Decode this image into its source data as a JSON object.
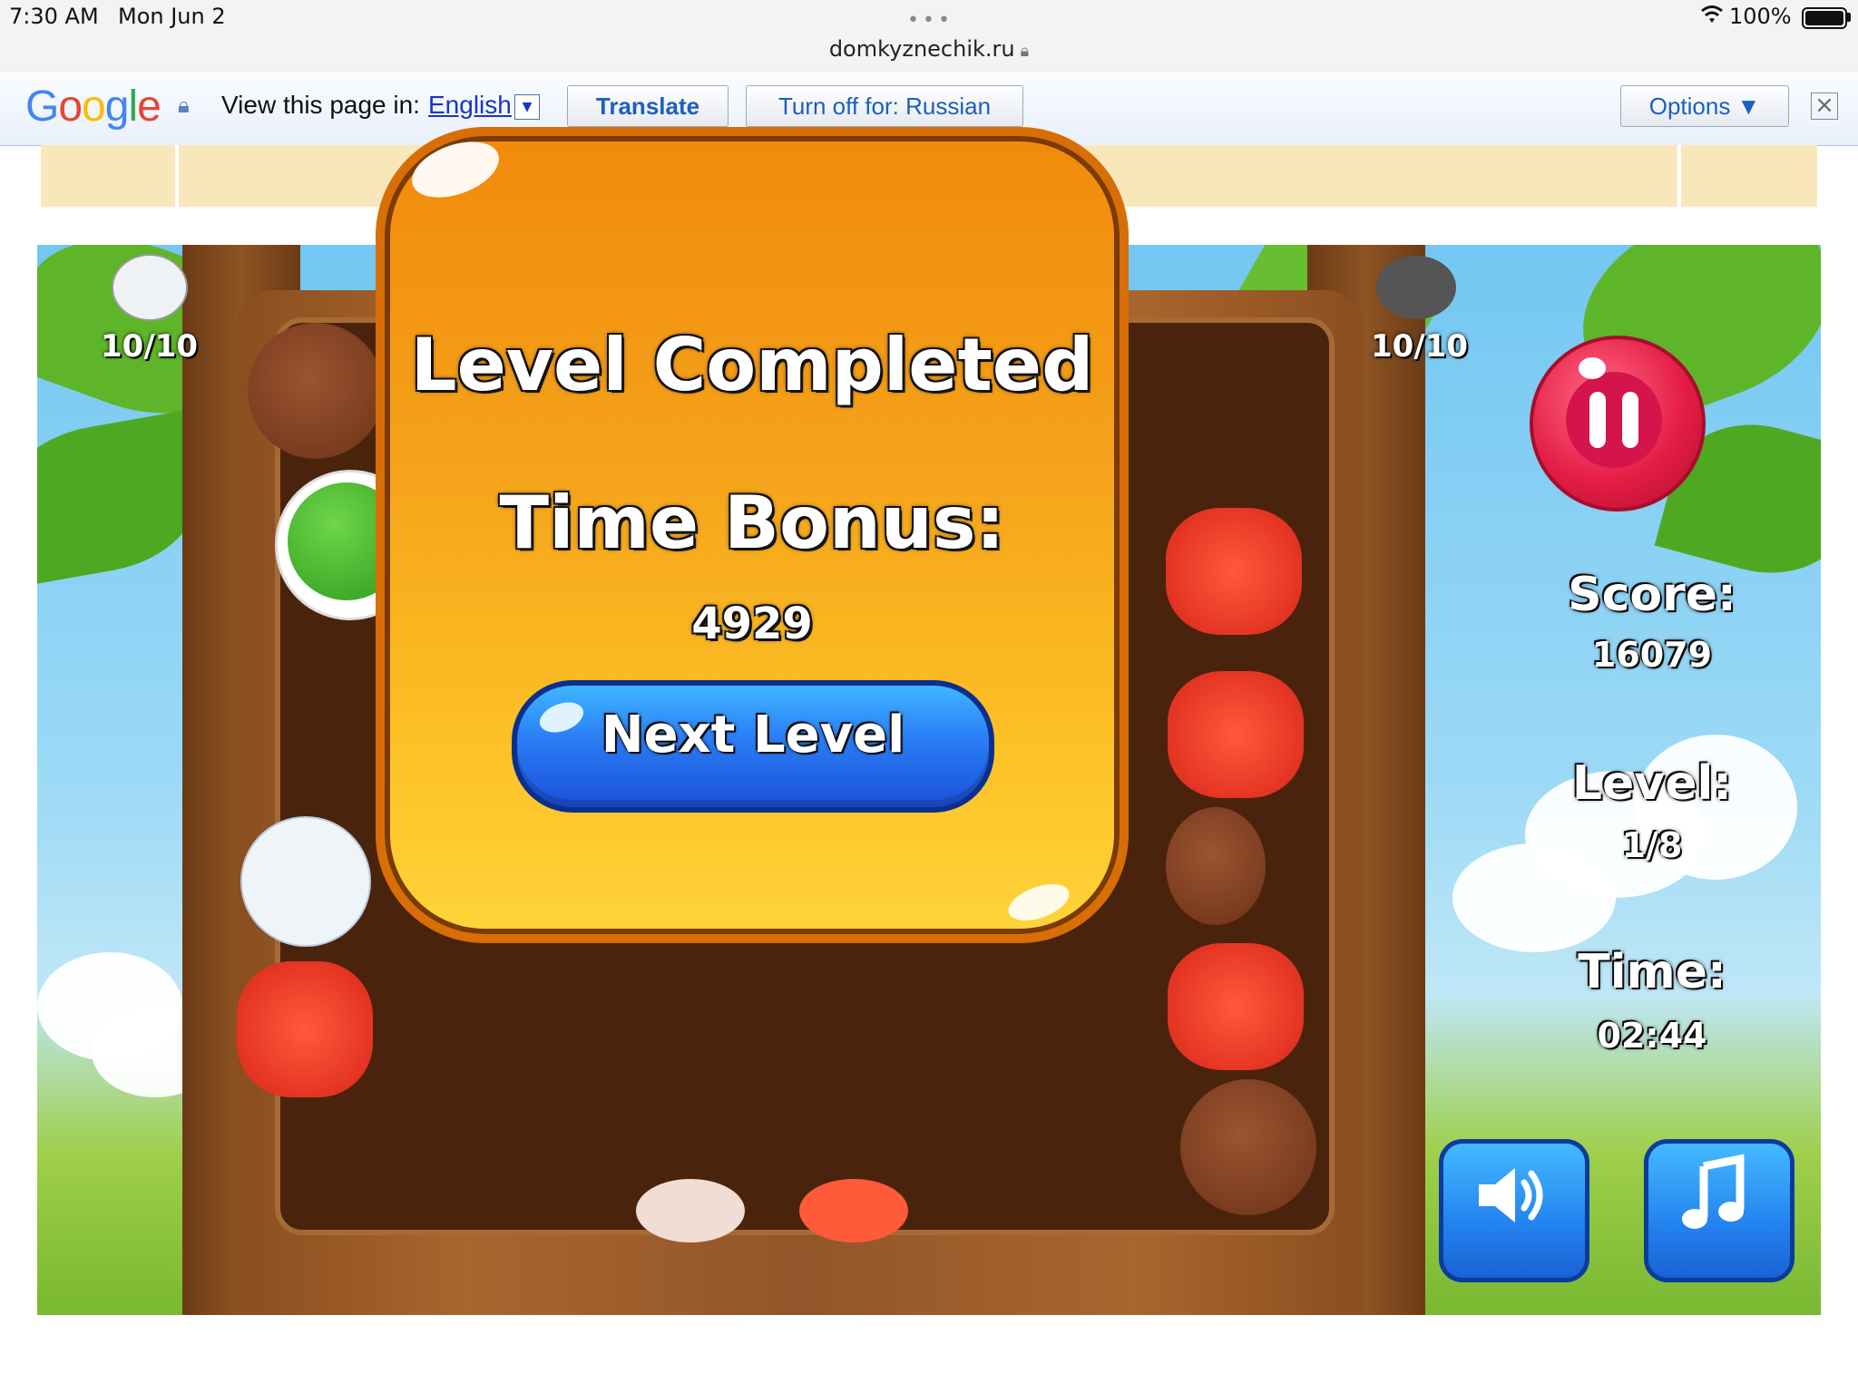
{
  "status_bar": {
    "time": "7:30 AM",
    "date": "Mon Jun 2",
    "url": "domkyznechik.ru",
    "battery": "100%"
  },
  "translate_bar": {
    "logo": "Google",
    "view_page_in": "View this page in:",
    "language": "English",
    "translate_label": "Translate",
    "turn_off_label": "Turn off for: Russian",
    "options_label": "Options ▼"
  },
  "game": {
    "left_counter": "10/10",
    "right_counter": "10/10",
    "score_label": "Score:",
    "score_value": "16079",
    "level_label": "Level:",
    "level_value": "1/8",
    "time_label": "Time:",
    "time_value": "02:44"
  },
  "modal": {
    "title": "Level Completed",
    "bonus_label": "Time Bonus:",
    "bonus_value": "4929",
    "next_button": "Next Level"
  },
  "icons": {
    "pause": "pause-icon",
    "sound": "speaker-icon",
    "music": "music-note-icon"
  },
  "colors": {
    "modal_orange": "#f5a21a",
    "next_button_blue": "#2a7cf5",
    "pause_red": "#e51e46",
    "google_link_blue": "#1a33cc"
  }
}
